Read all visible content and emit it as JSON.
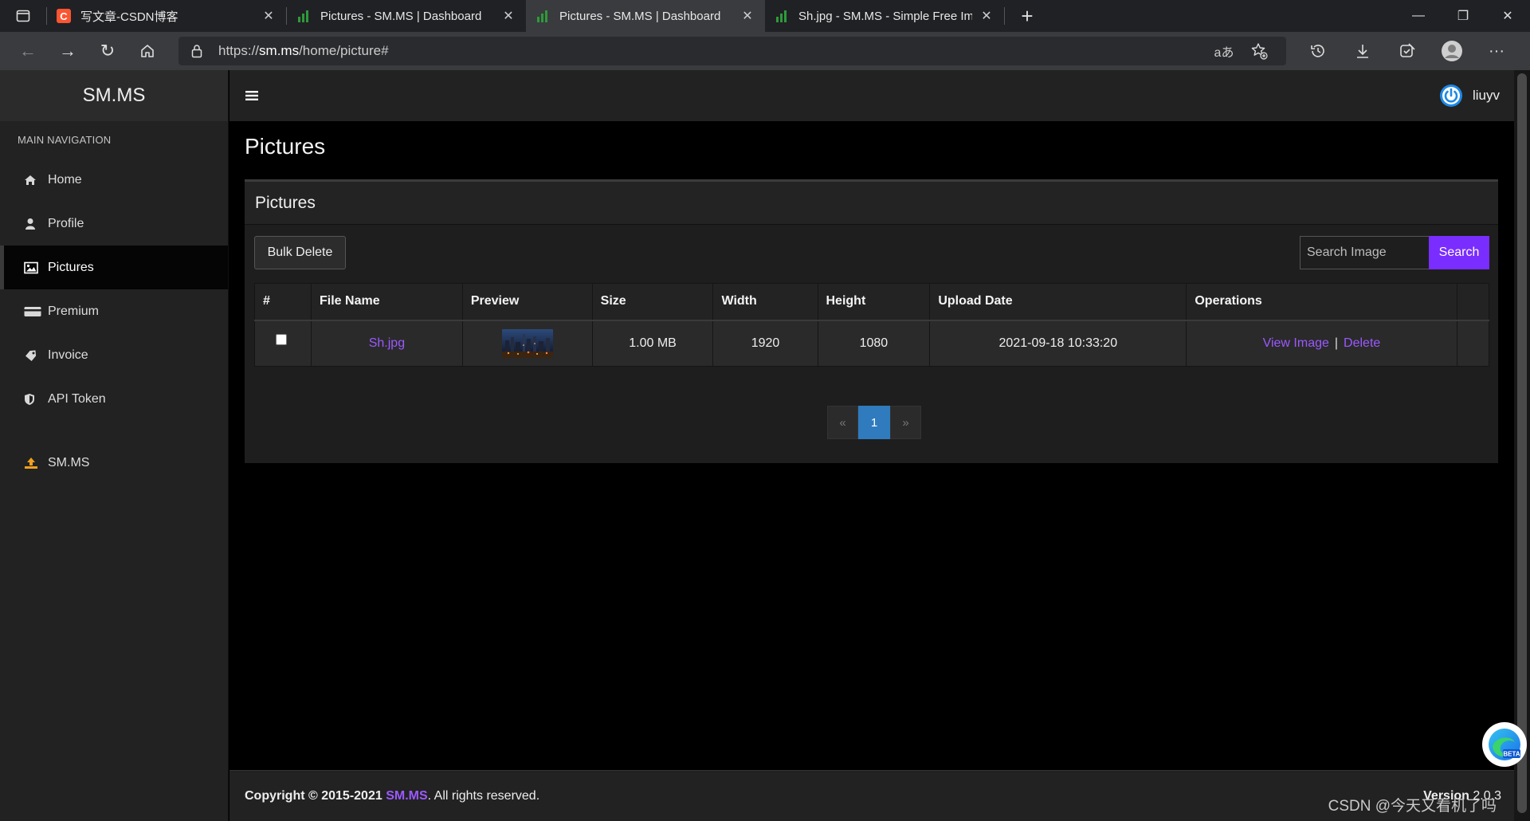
{
  "browser": {
    "tabs": [
      {
        "title": "写文章-CSDN博客",
        "active": false,
        "favicon": "csdn-icon"
      },
      {
        "title": "Pictures - SM.MS | Dashboard",
        "active": false,
        "favicon": "smms-bars-icon"
      },
      {
        "title": "Pictures - SM.MS | Dashboard",
        "active": true,
        "favicon": "smms-bars-icon"
      },
      {
        "title": "Sh.jpg - SM.MS - Simple Free Im",
        "active": false,
        "favicon": "smms-bars-icon"
      }
    ],
    "url_prefix": "https://",
    "url_host": "sm.ms",
    "url_path": "/home/picture#",
    "translate_label": "aあ"
  },
  "app": {
    "brand": "SM.MS",
    "nav_header": "MAIN NAVIGATION",
    "nav": [
      {
        "label": "Home",
        "icon": "home-icon",
        "active": false
      },
      {
        "label": "Profile",
        "icon": "user-icon",
        "active": false
      },
      {
        "label": "Pictures",
        "icon": "image-icon",
        "active": true
      },
      {
        "label": "Premium",
        "icon": "credit-card-icon",
        "active": false
      },
      {
        "label": "Invoice",
        "icon": "tag-icon",
        "active": false
      },
      {
        "label": "API Token",
        "icon": "shield-icon",
        "active": false
      }
    ],
    "nav_extra": {
      "label": "SM.MS",
      "icon": "upload-icon"
    },
    "username": "liuyv"
  },
  "main": {
    "page_title": "Pictures",
    "box_title": "Pictures",
    "bulk_delete_label": "Bulk Delete",
    "search_placeholder": "Search Image",
    "search_label": "Search",
    "table": {
      "headers": [
        "#",
        "File Name",
        "Preview",
        "Size",
        "Width",
        "Height",
        "Upload Date",
        "Operations"
      ],
      "rows": [
        {
          "file_name": "Sh.jpg",
          "size": "1.00 MB",
          "width": "1920",
          "height": "1080",
          "upload_date": "2021-09-18 10:33:20",
          "view_label": "View Image",
          "delete_label": "Delete"
        }
      ]
    },
    "pagination": {
      "prev": "«",
      "current": "1",
      "next": "»"
    }
  },
  "footer": {
    "copyright_prefix": "Copyright © 2015-2021 ",
    "copyright_link": "SM.MS",
    "copyright_suffix": ". All rights reserved.",
    "version_label": "Version",
    "version_value": "2.0.3"
  },
  "watermark": "CSDN @今天又看机了吗",
  "colors": {
    "accent_purple": "#7a2dff",
    "link_purple": "#9b59ff",
    "pager_blue": "#2f7bbd"
  }
}
